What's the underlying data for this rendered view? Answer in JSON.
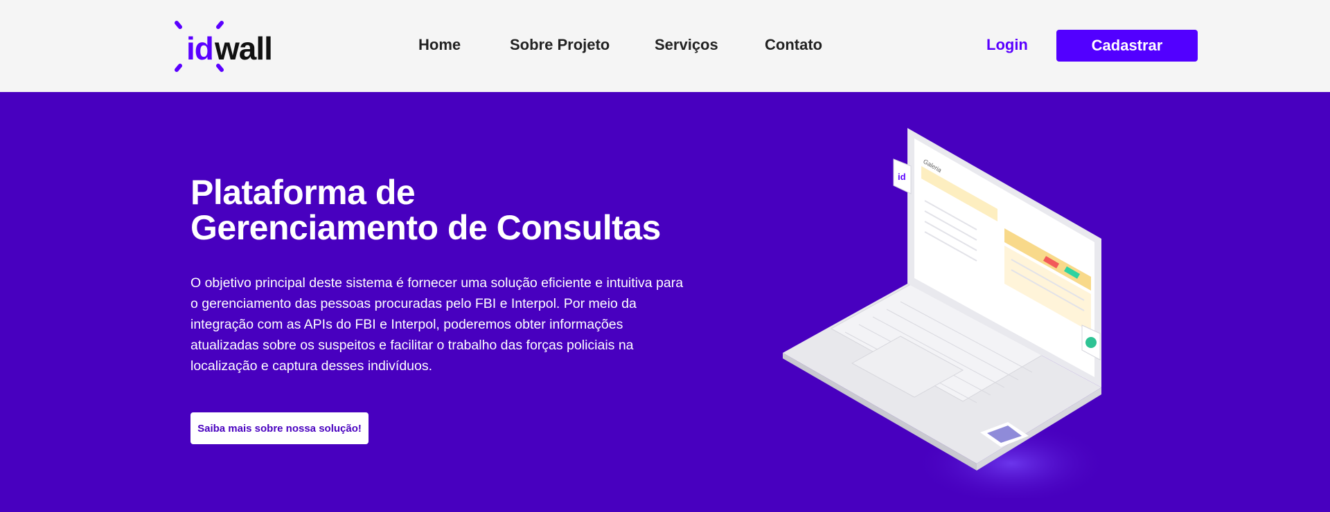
{
  "brand": {
    "logo_id": "id",
    "logo_wall": "wall",
    "primary_color": "#5200ff",
    "hero_bg": "#4800bf",
    "header_bg": "#f5f5f5"
  },
  "nav": {
    "items": [
      {
        "label": "Home"
      },
      {
        "label": "Sobre Projeto"
      },
      {
        "label": "Serviços"
      },
      {
        "label": "Contato"
      }
    ],
    "login_label": "Login",
    "signup_label": "Cadastrar"
  },
  "hero": {
    "title_line1": "Plataforma de",
    "title_line2": "Gerenciamento de Consultas",
    "description": "O objetivo principal deste sistema é fornecer uma solução eficiente e intuitiva para o gerenciamento das pessoas procuradas pelo FBI e Interpol. Por meio da integração com as APIs do FBI e Interpol, poderemos obter informações atualizadas sobre os suspeitos e facilitar o trabalho das forças policiais na localização e captura desses indivíduos.",
    "cta_label": "Saiba mais sobre nossa solução!"
  },
  "illustration": {
    "screen_title": "Galeria",
    "badge_text": "id"
  }
}
